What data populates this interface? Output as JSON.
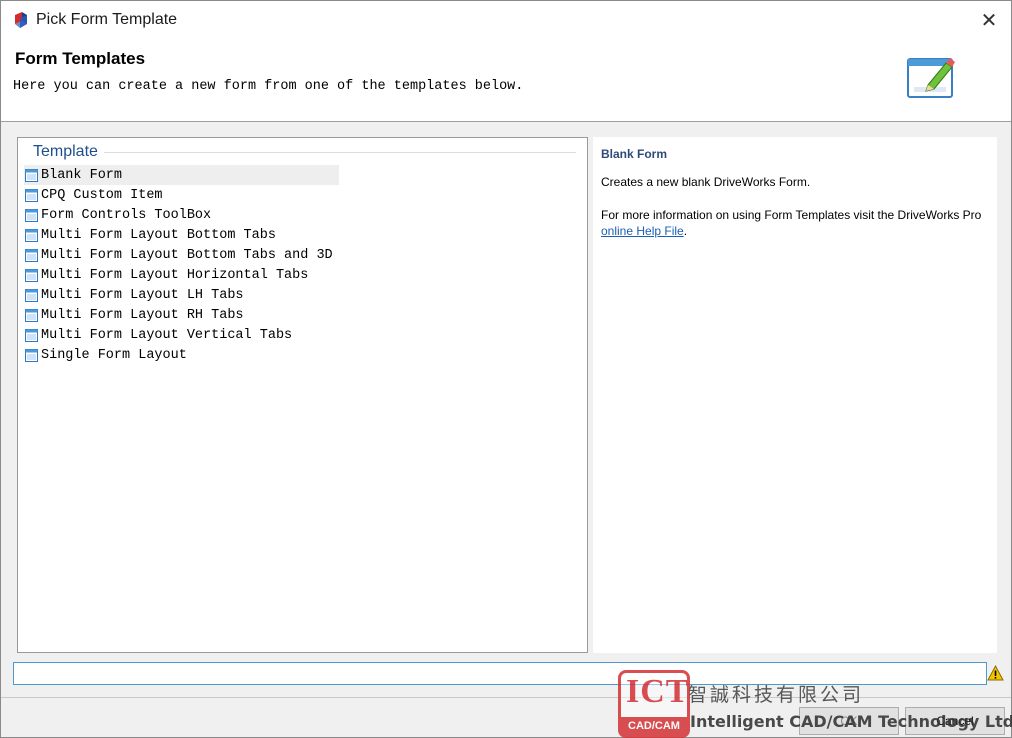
{
  "window": {
    "title": "Pick Form Template",
    "close_glyph": "✕",
    "icon": "app-cube-icon"
  },
  "header": {
    "title": "Form Templates",
    "subtitle": "Here you can create a new form from one of the templates below.",
    "icon": "form-edit-icon"
  },
  "template_group": {
    "label": "Template",
    "selected_index": 0,
    "items": [
      {
        "label": "Blank Form"
      },
      {
        "label": "CPQ Custom Item"
      },
      {
        "label": "Form Controls ToolBox"
      },
      {
        "label": "Multi Form Layout Bottom Tabs"
      },
      {
        "label": "Multi Form Layout Bottom Tabs and 3D"
      },
      {
        "label": "Multi Form Layout Horizontal Tabs"
      },
      {
        "label": "Multi Form Layout LH Tabs"
      },
      {
        "label": "Multi Form Layout RH Tabs"
      },
      {
        "label": "Multi Form Layout Vertical Tabs"
      },
      {
        "label": "Single Form Layout"
      }
    ]
  },
  "description": {
    "title": "Blank Form",
    "text": "Creates a new blank DriveWorks Form.",
    "more_prefix": "For more information on using Form Templates visit the DriveWorks Pro ",
    "link_text": "online Help File",
    "more_suffix": "."
  },
  "name_field": {
    "value": "",
    "placeholder": ""
  },
  "buttons": {
    "ok": "OK",
    "cancel": "Cancel"
  },
  "watermark": {
    "logo_text": "ICT",
    "logo_sub": "CAD/CAM",
    "chinese_name": "智誠科技有限公司",
    "english_name": "Intelligent CAD/CAM Technology Ltd."
  },
  "colors": {
    "accent": "#1f4e8c",
    "link": "#1a5fb4",
    "input_border": "#4d9ad0",
    "warning": "#f5c400",
    "watermark_red": "#d4373a"
  }
}
